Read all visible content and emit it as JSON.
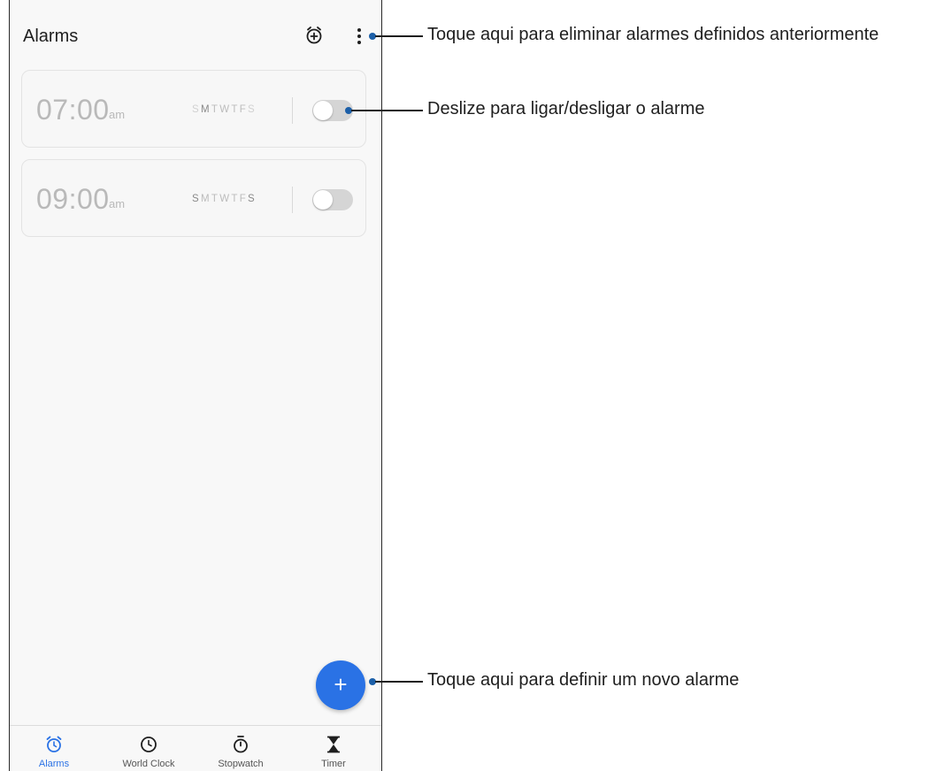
{
  "app": {
    "title": "Alarms"
  },
  "alarms": [
    {
      "time": "07:00",
      "ampm": "am",
      "days": [
        "S",
        "M",
        "T",
        "W",
        "T",
        "F",
        "S"
      ],
      "enabled": false
    },
    {
      "time": "09:00",
      "ampm": "am",
      "days": [
        "S",
        "M",
        "T",
        "W",
        "T",
        "F",
        "S"
      ],
      "enabled": false
    }
  ],
  "fab": {
    "label": "+"
  },
  "bottom_nav": [
    {
      "label": "Alarms",
      "icon": "alarm-clock-icon",
      "active": true
    },
    {
      "label": "World Clock",
      "icon": "clock-icon",
      "active": false
    },
    {
      "label": "Stopwatch",
      "icon": "stopwatch-icon",
      "active": false
    },
    {
      "label": "Timer",
      "icon": "hourglass-icon",
      "active": false
    }
  ],
  "callouts": {
    "menu": "Toque aqui para eliminar alarmes definidos anteriormente",
    "toggle": "Deslize para ligar/desligar o alarme",
    "fab": "Toque aqui para definir um novo alarme"
  },
  "colors": {
    "accent": "#2a72e5",
    "callout_dot": "#1c5fa8",
    "disabled_text": "#b9b9b9"
  }
}
